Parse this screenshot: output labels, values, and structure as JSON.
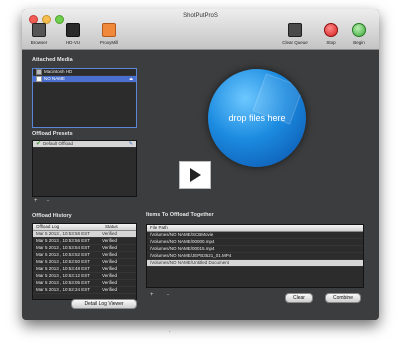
{
  "window": {
    "title": "ShotPutProS"
  },
  "toolbar": {
    "left": [
      {
        "label": "Browser",
        "icon": "browser-icon"
      },
      {
        "label": "HD-VU",
        "icon": "film-icon"
      },
      {
        "label": "ProxyMill",
        "icon": "proxymill-icon"
      }
    ],
    "right": [
      {
        "label": "Clear Queue",
        "icon": "clear-queue-icon"
      },
      {
        "label": "Stop",
        "icon": "stop-icon"
      },
      {
        "label": "Begin",
        "icon": "begin-icon"
      }
    ]
  },
  "attached_media": {
    "title": "Attached Media",
    "items": [
      "Macintosh HD",
      "NO NAME"
    ]
  },
  "offload_presets": {
    "title": "Offload Presets",
    "items": [
      "Default Offload"
    ],
    "add_label": "+",
    "remove_label": "-"
  },
  "offload_history": {
    "title": "Offload History",
    "col_log": "Offload Log",
    "col_status": "Status",
    "rows": [
      {
        "log": "Mar 5 2013 , 10:53:58 EST",
        "status": "Verified"
      },
      {
        "log": "Mar 5 2013 , 10:53:56 EST",
        "status": "Verified"
      },
      {
        "log": "Mar 5 2013 , 10:53:54 EST",
        "status": "Verified"
      },
      {
        "log": "Mar 5 2013 , 10:53:52 EST",
        "status": "Verified"
      },
      {
        "log": "Mar 5 2013 , 10:53:50 EST",
        "status": "Verified"
      },
      {
        "log": "Mar 5 2013 , 10:53:48 EST",
        "status": "Verified"
      },
      {
        "log": "Mar 5 2013 , 10:53:12 EST",
        "status": "Verified"
      },
      {
        "log": "Mar 5 2013 , 10:53:05 EST",
        "status": "Verified"
      },
      {
        "log": "Mar 5 2013 , 10:52:24 EST",
        "status": "Verified"
      }
    ],
    "detail_button": "Detail Log Viewer"
  },
  "drop_zone": {
    "text": "drop files here"
  },
  "offload_together": {
    "title": "Items To Offload Together",
    "col_path": "File Path",
    "rows": [
      "/Volumes/NO NAME/SCBMovie",
      "/Volumes/NO NAME/00000.mp4",
      "/Volumes/NO NAME/00015.mp4",
      "/Volumes/NO NAME/JEPB3521_01.MP4",
      "/Volumes/NO NAME/Untitled Document"
    ],
    "add_label": "+",
    "remove_label": "-",
    "clear_button": "Clear",
    "combine_button": "Combine"
  }
}
